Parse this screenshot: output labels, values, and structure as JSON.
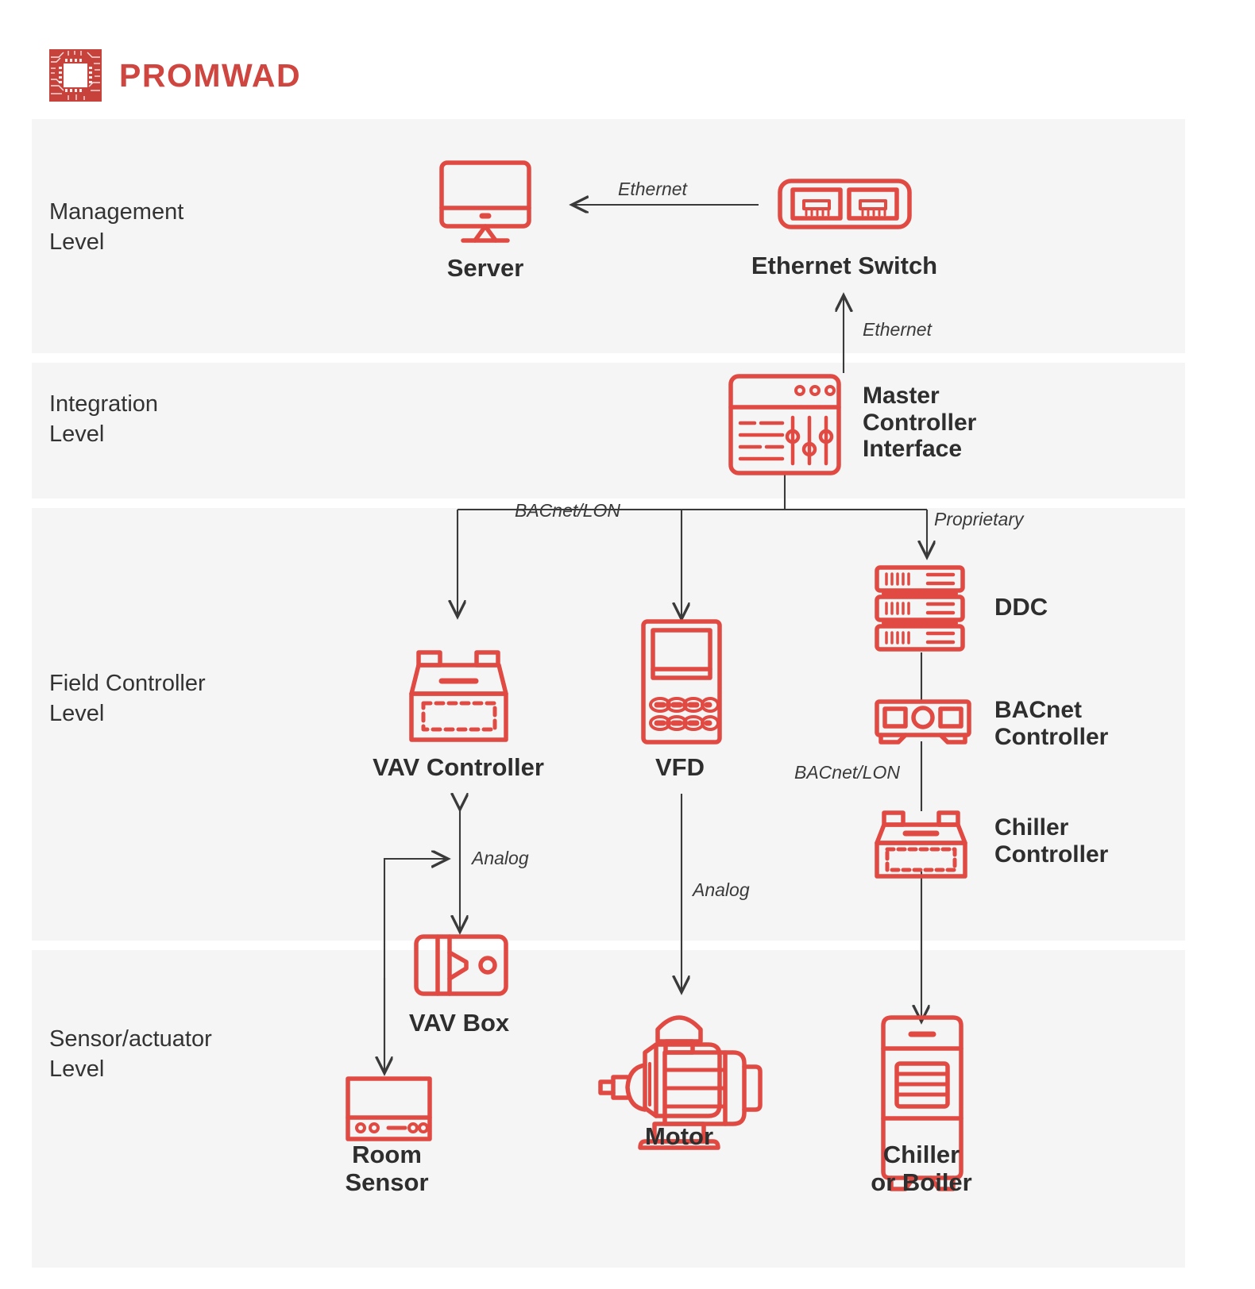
{
  "brand": {
    "name": "PROMWAD",
    "logo_icon": "promwad-circuit-logo",
    "accent_color": "#cf4641",
    "icon_color": "#e04a42",
    "band_color": "#f5f5f5",
    "text_color": "#2e2e2e"
  },
  "bands": [
    {
      "id": "management",
      "label": "Management\nLevel"
    },
    {
      "id": "integration",
      "label": "Integration\nLevel"
    },
    {
      "id": "field",
      "label": "Field Controller\nLevel"
    },
    {
      "id": "sensor",
      "label": "Sensor/actuator\nLevel"
    }
  ],
  "nodes": {
    "server": {
      "label": "Server",
      "icon": "monitor-icon"
    },
    "ethernet_switch": {
      "label": "Ethernet Switch",
      "icon": "ethernet-switch-icon"
    },
    "master_controller": {
      "label": "Master\nController\nInterface",
      "icon": "controller-interface-icon"
    },
    "vav_controller": {
      "label": "VAV Controller",
      "icon": "controller-box-icon"
    },
    "vfd": {
      "label": "VFD",
      "icon": "vfd-keypad-icon"
    },
    "ddc": {
      "label": "DDC",
      "icon": "server-stack-icon"
    },
    "bacnet_controller": {
      "label": "BACnet\nController",
      "icon": "bacnet-device-icon"
    },
    "chiller_controller": {
      "label": "Chiller\nController",
      "icon": "controller-box-icon"
    },
    "vav_box": {
      "label": "VAV Box",
      "icon": "vav-damper-icon"
    },
    "room_sensor": {
      "label": "Room\nSensor",
      "icon": "room-sensor-icon"
    },
    "motor": {
      "label": "Motor",
      "icon": "electric-motor-icon"
    },
    "chiller_boiler": {
      "label": "Chiller\nor Boiler",
      "icon": "chiller-boiler-icon"
    }
  },
  "links": [
    {
      "id": "eth-top",
      "label": "Ethernet",
      "from": "ethernet_switch",
      "to": "server"
    },
    {
      "id": "eth-mid",
      "label": "Ethernet",
      "from": "master_controller",
      "to": "ethernet_switch"
    },
    {
      "id": "bacnet-lon-1",
      "label": "BACnet/LON",
      "from": "master_controller",
      "to": "vav_controller"
    },
    {
      "id": "proprietary",
      "label": "Proprietary",
      "from": "master_controller",
      "to": "ddc"
    },
    {
      "id": "analog-vav",
      "label": "Analog",
      "from": "vav_controller",
      "to": "vav_box"
    },
    {
      "id": "analog-vfd",
      "label": "Analog",
      "from": "vfd",
      "to": "motor"
    },
    {
      "id": "bacnet-lon-2",
      "label": "BACnet/LON",
      "from": "bacnet_controller",
      "to": "chiller_controller"
    }
  ],
  "chart_data": {
    "type": "diagram",
    "title": "Building Management System Architecture Levels",
    "levels": [
      "Management Level",
      "Integration Level",
      "Field Controller Level",
      "Sensor/actuator Level"
    ],
    "nodes": [
      {
        "name": "Server",
        "level": "Management Level"
      },
      {
        "name": "Ethernet Switch",
        "level": "Management Level"
      },
      {
        "name": "Master Controller Interface",
        "level": "Integration Level"
      },
      {
        "name": "VAV Controller",
        "level": "Field Controller Level"
      },
      {
        "name": "VFD",
        "level": "Field Controller Level"
      },
      {
        "name": "DDC",
        "level": "Field Controller Level"
      },
      {
        "name": "BACnet Controller",
        "level": "Field Controller Level"
      },
      {
        "name": "Chiller Controller",
        "level": "Field Controller Level"
      },
      {
        "name": "VAV Box",
        "level": "Sensor/actuator Level"
      },
      {
        "name": "Room Sensor",
        "level": "Sensor/actuator Level"
      },
      {
        "name": "Motor",
        "level": "Sensor/actuator Level"
      },
      {
        "name": "Chiller or Boiler",
        "level": "Sensor/actuator Level"
      }
    ],
    "edges": [
      {
        "from": "Ethernet Switch",
        "to": "Server",
        "protocol": "Ethernet",
        "direction": "one-way"
      },
      {
        "from": "Master Controller Interface",
        "to": "Ethernet Switch",
        "protocol": "Ethernet",
        "direction": "one-way"
      },
      {
        "from": "Master Controller Interface",
        "to": "VAV Controller",
        "protocol": "BACnet/LON",
        "direction": "one-way"
      },
      {
        "from": "Master Controller Interface",
        "to": "VFD",
        "protocol": "BACnet/LON",
        "direction": "one-way"
      },
      {
        "from": "Master Controller Interface",
        "to": "DDC",
        "protocol": "Proprietary",
        "direction": "one-way"
      },
      {
        "from": "DDC",
        "to": "BACnet Controller",
        "protocol": "",
        "direction": "one-way"
      },
      {
        "from": "BACnet Controller",
        "to": "Chiller Controller",
        "protocol": "BACnet/LON",
        "direction": "one-way"
      },
      {
        "from": "VAV Controller",
        "to": "VAV Box",
        "protocol": "Analog",
        "direction": "two-way"
      },
      {
        "from": "Room Sensor",
        "to": "VAV Controller",
        "protocol": "Analog",
        "direction": "one-way"
      },
      {
        "from": "VFD",
        "to": "Motor",
        "protocol": "Analog",
        "direction": "one-way"
      },
      {
        "from": "Chiller Controller",
        "to": "Chiller or Boiler",
        "protocol": "",
        "direction": "one-way"
      }
    ]
  }
}
